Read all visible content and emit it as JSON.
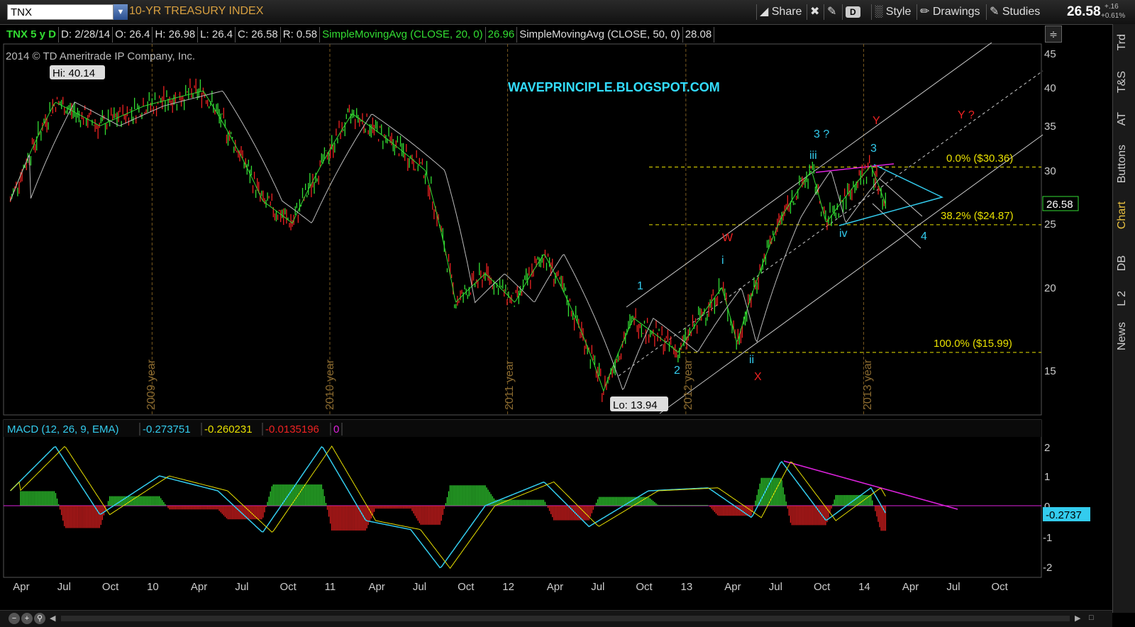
{
  "toolbar": {
    "symbol": "TNX",
    "index_name": "10-YR TREASURY INDEX",
    "share": "Share",
    "d_badge": "D",
    "style": "Style",
    "drawings": "Drawings",
    "studies": "Studies",
    "last_price": "26.58",
    "change_abs": "+.16",
    "change_pct": "+0.61%"
  },
  "side_tabs": [
    "Trd",
    "T&S",
    "AT",
    "Buttons",
    "Chart",
    "DB",
    "L 2",
    "News"
  ],
  "header": {
    "period": "TNX 5 y D",
    "date": "D: 2/28/14",
    "open": "O: 26.4",
    "high": "H: 26.98",
    "low": "L: 26.4",
    "close": "C: 26.58",
    "range": "R: 0.58",
    "sma20_label": "SimpleMovingAvg (CLOSE, 20, 0)",
    "sma20_value": "26.96",
    "sma50_label": "SimpleMovingAvg (CLOSE, 50, 0)",
    "sma50_value": "28.08"
  },
  "price_chart": {
    "copyright": "2014 © TD Ameritrade IP Company, Inc.",
    "watermark": "WAVEPRINCIPLE.BLOGSPOT.COM",
    "hi_label": "Hi: 40.14",
    "lo_label": "Lo: 13.94",
    "price_axis": [
      "45",
      "40",
      "35",
      "30",
      "25",
      "20",
      "15"
    ],
    "current_price_tag": "26.58",
    "year_markers": [
      "2009 year",
      "2010 year",
      "2011 year",
      "2012 year",
      "2013 year"
    ],
    "fib_levels": [
      {
        "label": "0.0%  ($30.36)",
        "value": 30.36
      },
      {
        "label": "38.2%  ($24.87)",
        "value": 24.87
      },
      {
        "label": "100.0%  ($15.99)",
        "value": 15.99
      }
    ],
    "wave_labels": [
      {
        "text": "1",
        "color": "#33ccee"
      },
      {
        "text": "2",
        "color": "#33ccee"
      },
      {
        "text": "i",
        "color": "#33ccee"
      },
      {
        "text": "ii",
        "color": "#33ccee"
      },
      {
        "text": "iii",
        "color": "#33ccee"
      },
      {
        "text": "iv",
        "color": "#33ccee"
      },
      {
        "text": "3 ?",
        "color": "#33ccee"
      },
      {
        "text": "3",
        "color": "#33ccee"
      },
      {
        "text": "4",
        "color": "#33ccee"
      },
      {
        "text": "W",
        "color": "#ee2222"
      },
      {
        "text": "X",
        "color": "#ee2222"
      },
      {
        "text": "Y",
        "color": "#ee2222"
      },
      {
        "text": "Y ?",
        "color": "#ee2222"
      }
    ]
  },
  "macd": {
    "label": "MACD (12, 26, 9, EMA)",
    "value": "-0.273751",
    "avg": "-0.260231",
    "diff": "-0.0135196",
    "zero": "0",
    "axis": [
      "2",
      "1",
      "0",
      "-1",
      "-2"
    ],
    "current_tag": "-0.2737"
  },
  "time_axis": [
    "Apr",
    "Jul",
    "Oct",
    "10",
    "Apr",
    "Jul",
    "Oct",
    "11",
    "Apr",
    "Jul",
    "Oct",
    "12",
    "Apr",
    "Jul",
    "Oct",
    "13",
    "Apr",
    "Jul",
    "Oct",
    "14",
    "Apr",
    "Jul",
    "Oct"
  ],
  "chart_data": {
    "type": "line",
    "title": "10-YR TREASURY INDEX",
    "series": [
      {
        "name": "TNX",
        "points": [
          [
            "2009-03",
            27
          ],
          [
            "2009-06",
            38
          ],
          [
            "2009-09",
            35
          ],
          [
            "2009-12",
            37.5
          ],
          [
            "2010-04",
            39.5
          ],
          [
            "2010-08",
            27
          ],
          [
            "2010-10",
            25
          ],
          [
            "2011-02",
            36.5
          ],
          [
            "2011-04",
            34
          ],
          [
            "2011-07",
            30
          ],
          [
            "2011-09",
            19
          ],
          [
            "2011-11",
            21
          ],
          [
            "2012-01",
            19
          ],
          [
            "2012-03",
            22.5
          ],
          [
            "2012-07",
            14
          ],
          [
            "2012-09",
            18
          ],
          [
            "2012-12",
            16
          ],
          [
            "2013-03",
            20
          ],
          [
            "2013-04",
            16.5
          ],
          [
            "2013-07",
            25.5
          ],
          [
            "2013-09",
            30
          ],
          [
            "2013-10",
            25
          ],
          [
            "2014-01",
            30.5
          ],
          [
            "2014-02",
            26.58
          ]
        ]
      }
    ],
    "macd_points": [
      [
        "2009-03",
        0.5
      ],
      [
        "2009-06",
        2
      ],
      [
        "2009-09",
        -0.3
      ],
      [
        "2010-01",
        1
      ],
      [
        "2010-05",
        0.5
      ],
      [
        "2010-08",
        -0.9
      ],
      [
        "2010-12",
        2
      ],
      [
        "2011-03",
        -0.5
      ],
      [
        "2011-06",
        -0.8
      ],
      [
        "2011-08",
        -2.1
      ],
      [
        "2011-11",
        0
      ],
      [
        "2012-03",
        0.8
      ],
      [
        "2012-06",
        -0.7
      ],
      [
        "2012-10",
        0.5
      ],
      [
        "2013-02",
        0.6
      ],
      [
        "2013-05",
        -0.4
      ],
      [
        "2013-07",
        1.5
      ],
      [
        "2013-10",
        -0.5
      ],
      [
        "2014-01",
        0.6
      ],
      [
        "2014-02",
        -0.27
      ]
    ],
    "ylim": [
      12,
      47
    ],
    "macd_ylim": [
      -2.3,
      2.3
    ]
  },
  "colors": {
    "up": "#33dd33",
    "down": "#ee2222",
    "sma20": "#22cc22",
    "sma50": "#bbbbbb",
    "fib": "#e8e000",
    "channel": "#cccccc",
    "triangle": "#33ccee",
    "trend": "#dd22dd",
    "accent": "#d8a040"
  }
}
